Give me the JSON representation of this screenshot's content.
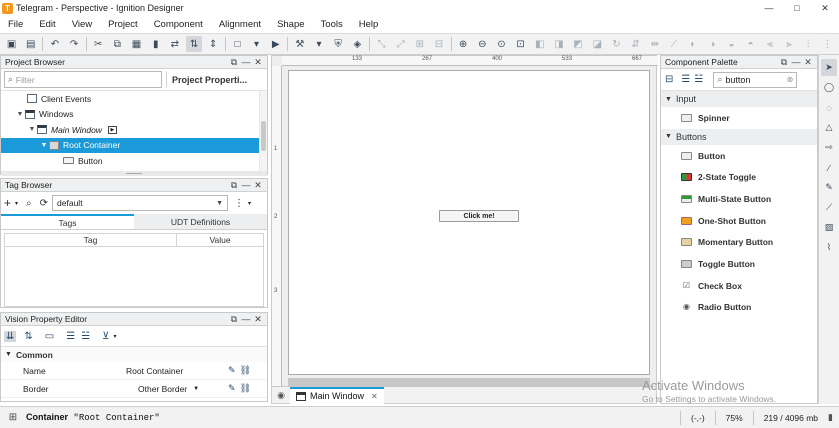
{
  "window": {
    "title": "Telegram - Perspective - Ignition Designer",
    "app_icon": "T",
    "minimize": "—",
    "maximize": "□",
    "close": "✕"
  },
  "menu": [
    "File",
    "Edit",
    "View",
    "Project",
    "Component",
    "Alignment",
    "Shape",
    "Tools",
    "Help"
  ],
  "project_browser": {
    "title": "Project Browser",
    "filter_placeholder": "Filter",
    "properties_button": "Project Properti...",
    "tree": [
      {
        "label": "Client Events",
        "indent": 1
      },
      {
        "label": "Windows",
        "indent": 0
      },
      {
        "label": "Main Window",
        "indent": 1
      },
      {
        "label": "Root Container",
        "indent": 2
      },
      {
        "label": "Button",
        "indent": 3
      }
    ]
  },
  "tag_browser": {
    "title": "Tag Browser",
    "provider": "default",
    "tabs": [
      "Tags",
      "UDT Definitions"
    ],
    "columns": [
      "Tag",
      "Value"
    ]
  },
  "property_editor": {
    "title": "Vision Property Editor",
    "section": "Common",
    "rows": [
      {
        "name": "Name",
        "value": "Root Container"
      },
      {
        "name": "Border",
        "value": "Other Border"
      }
    ]
  },
  "workspace": {
    "ruler_labels": [
      "133",
      "267",
      "400",
      "533",
      "667"
    ],
    "ruler_left_labels": [
      "1",
      "2",
      "3"
    ],
    "button_label": "Click me!",
    "tab": "Main Window"
  },
  "component_palette": {
    "title": "Component Palette",
    "search_value": "button",
    "groups": [
      {
        "name": "Input",
        "items": [
          {
            "label": "Spinner",
            "icon": "spinner-icon"
          }
        ]
      },
      {
        "name": "Buttons",
        "items": [
          {
            "label": "Button",
            "icon": "button-icon"
          },
          {
            "label": "2-State Toggle",
            "icon": "toggle-icon"
          },
          {
            "label": "Multi-State Button",
            "icon": "multistate-icon"
          },
          {
            "label": "One-Shot Button",
            "icon": "oneshot-icon"
          },
          {
            "label": "Momentary Button",
            "icon": "momentary-icon"
          },
          {
            "label": "Toggle Button",
            "icon": "togglebutton-icon"
          },
          {
            "label": "Check Box",
            "icon": "checkbox-icon"
          },
          {
            "label": "Radio Button",
            "icon": "radio-icon"
          }
        ]
      }
    ]
  },
  "watermark": {
    "title": "Activate Windows",
    "subtitle": "Go to Settings to activate Windows."
  },
  "status": {
    "prefix": "Container",
    "value": "\"Root Container\"",
    "coords": "(-,-)",
    "zoom": "75%",
    "memory": "219 / 4096 mb"
  }
}
